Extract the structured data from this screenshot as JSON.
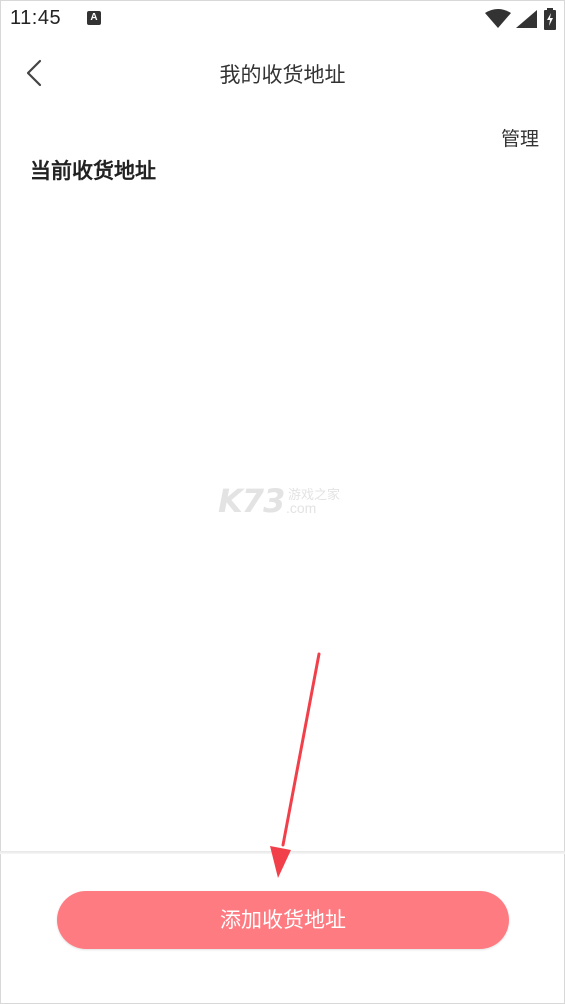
{
  "status_bar": {
    "time": "11:45",
    "notification_badge": "A",
    "icons": [
      "wifi-icon",
      "signal-icon",
      "battery-charging-icon"
    ]
  },
  "nav": {
    "title": "我的收货地址",
    "back_icon": "chevron-left-icon"
  },
  "manage_label": "管理",
  "section_title": "当前收货地址",
  "watermark": {
    "logo": "K73",
    "site_name": "游戏之家",
    "domain": ".com"
  },
  "add_button_label": "添加收货地址",
  "colors": {
    "accent": "#ff7b82",
    "annotation_arrow": "#f2404b"
  }
}
